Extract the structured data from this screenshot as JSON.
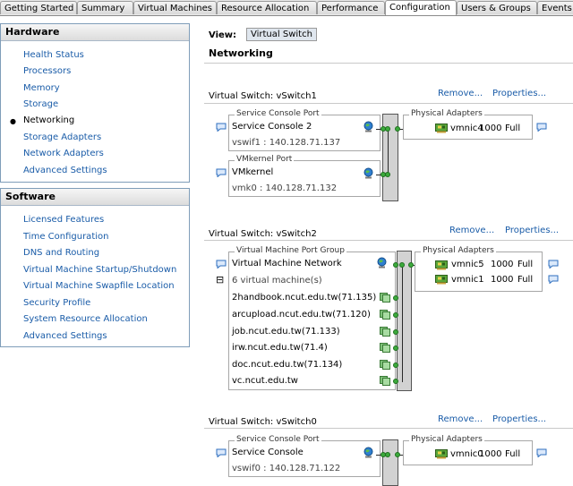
{
  "tabs": [
    "Getting Started",
    "Summary",
    "Virtual Machines",
    "Resource Allocation",
    "Performance",
    "Configuration",
    "Users & Groups",
    "Events"
  ],
  "hardware": {
    "title": "Hardware",
    "items": [
      "Health Status",
      "Processors",
      "Memory",
      "Storage",
      "Networking",
      "Storage Adapters",
      "Network Adapters",
      "Advanced Settings"
    ]
  },
  "software": {
    "title": "Software",
    "items": [
      "Licensed Features",
      "Time Configuration",
      "DNS and Routing",
      "Virtual Machine Startup/Shutdown",
      "Virtual Machine Swapfile Location",
      "Security Profile",
      "System Resource Allocation",
      "Advanced Settings"
    ]
  },
  "view": {
    "label": "View:",
    "button": "Virtual Switch"
  },
  "section_title": "Networking",
  "actions": {
    "remove": "Remove...",
    "properties": "Properties..."
  },
  "switch1": {
    "title": "Virtual Switch: vSwitch1",
    "group1": {
      "legend": "Service Console Port",
      "name": "Service Console 2",
      "detail": "vswif1 : 140.128.71.137"
    },
    "group2": {
      "legend": "VMkernel Port",
      "name": "VMkernel",
      "detail": "vmk0 : 140.128.71.132"
    },
    "adapters": {
      "legend": "Physical Adapters",
      "nics": [
        {
          "name": "vmnic4",
          "speed": "1000",
          "duplex": "Full"
        }
      ]
    }
  },
  "switch2": {
    "title": "Virtual Switch: vSwitch2",
    "group": {
      "legend": "Virtual Machine Port Group",
      "name": "Virtual Machine Network",
      "vm_count": "6 virtual machine(s)",
      "toggle": "⊟"
    },
    "vms": [
      "2handbook.ncut.edu.tw(71.135)",
      "arcupload.ncut.edu.tw(71.120)",
      "job.ncut.edu.tw(71.133)",
      "irw.ncut.edu.tw(71.4)",
      "doc.ncut.edu.tw(71.134)",
      "vc.ncut.edu.tw"
    ],
    "adapters": {
      "legend": "Physical Adapters",
      "nics": [
        {
          "name": "vmnic5",
          "speed": "1000",
          "duplex": "Full"
        },
        {
          "name": "vmnic1",
          "speed": "1000",
          "duplex": "Full"
        }
      ]
    }
  },
  "switch0": {
    "title": "Virtual Switch: vSwitch0",
    "group": {
      "legend": "Service Console Port",
      "name": "Service Console",
      "detail": "vswif0 : 140.128.71.122"
    },
    "adapters": {
      "legend": "Physical Adapters",
      "nics": [
        {
          "name": "vmnic0",
          "speed": "1000",
          "duplex": "Full"
        }
      ]
    }
  },
  "colors": {
    "link": "#1a5ca8",
    "port_green": "#3caa3c",
    "bar_grey": "#d2d2d2"
  }
}
